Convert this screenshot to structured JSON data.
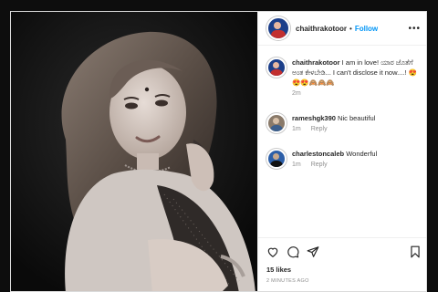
{
  "post": {
    "username": "chaithrakotoor",
    "separator": "•",
    "follow_label": "Follow",
    "more_icon": "more-horizontal-icon",
    "photo_description": "black-and-white portrait"
  },
  "comments": [
    {
      "username": "chaithrakotoor",
      "text": "I am in love! ಯಾರ ಜೊತೆಗೆ ಅಂತ ಕೇಳಬೇಡಿ... I can't disclose it now....! 😍😍😍🙈🙈🙈",
      "time": "2m",
      "reply": ""
    },
    {
      "username": "rameshgk390",
      "text": "Nic beautiful",
      "time": "1m",
      "reply": "Reply"
    },
    {
      "username": "charlestoncaleb",
      "text": "Wonderful",
      "time": "1m",
      "reply": "Reply"
    }
  ],
  "actions": {
    "like_icon": "heart-icon",
    "comment_icon": "comment-icon",
    "share_icon": "send-icon",
    "save_icon": "bookmark-icon"
  },
  "likes": "15 likes",
  "posted_ago": "2 MINUTES AGO",
  "colors": {
    "follow": "#0095f6",
    "muted": "#8e8e8e",
    "text": "#262626"
  }
}
